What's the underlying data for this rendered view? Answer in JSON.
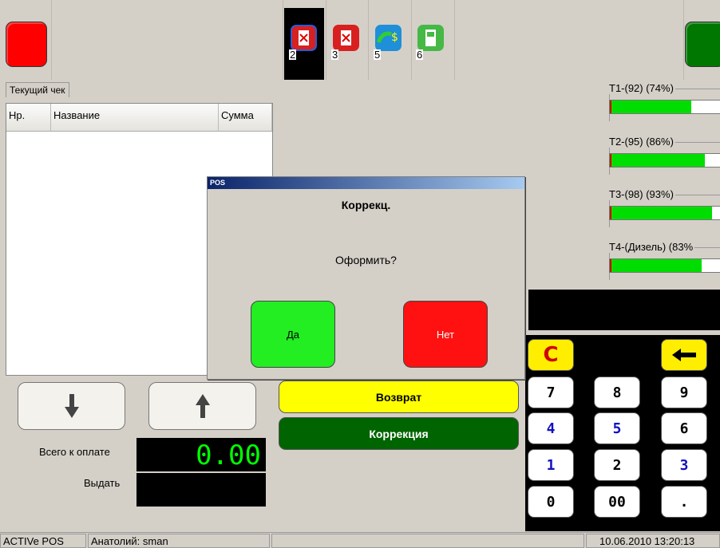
{
  "top_bar": {
    "pumps": [
      {
        "number": "2",
        "state": "blocked",
        "selected": true
      },
      {
        "number": "3",
        "state": "blocked",
        "selected": false
      },
      {
        "number": "5",
        "state": "prepaid",
        "selected": false
      },
      {
        "number": "6",
        "state": "idle",
        "selected": false
      }
    ],
    "colors": {
      "left_button": "#ff0000",
      "right_button": "#007700"
    }
  },
  "receipt": {
    "tab_label": "Текущий чек",
    "columns": {
      "num": "Нр.",
      "name": "Название",
      "sum": "Сумма"
    },
    "rows": []
  },
  "totals": {
    "total_label": "Всего к оплате",
    "total_value": "0.00",
    "change_label": "Выдать",
    "change_value": ""
  },
  "actions": {
    "return_label": "Возврат",
    "correction_label": "Коррекция"
  },
  "tanks": [
    {
      "label": "T1-(92) (74%)",
      "level": 0.74
    },
    {
      "label": "T2-(95) (86%)",
      "level": 0.86
    },
    {
      "label": "T3-(98) (93%)",
      "level": 0.93
    },
    {
      "label": "T4-(Дизель) (83%",
      "level": 0.83
    }
  ],
  "keypad": {
    "clear": "C",
    "backspace": "←",
    "keys": [
      "7",
      "8",
      "9",
      "4",
      "5",
      "6",
      "1",
      "2",
      "3",
      "0",
      "00",
      "."
    ]
  },
  "dialog": {
    "window_title": "POS",
    "heading": "Коррекц.",
    "question": "Оформить?",
    "yes_label": "Да",
    "no_label": "Нет"
  },
  "status_bar": {
    "app_name": "ACTIVe POS",
    "user": "Анатолий: sman",
    "datetime": "10.06.2010 13:20:13"
  }
}
